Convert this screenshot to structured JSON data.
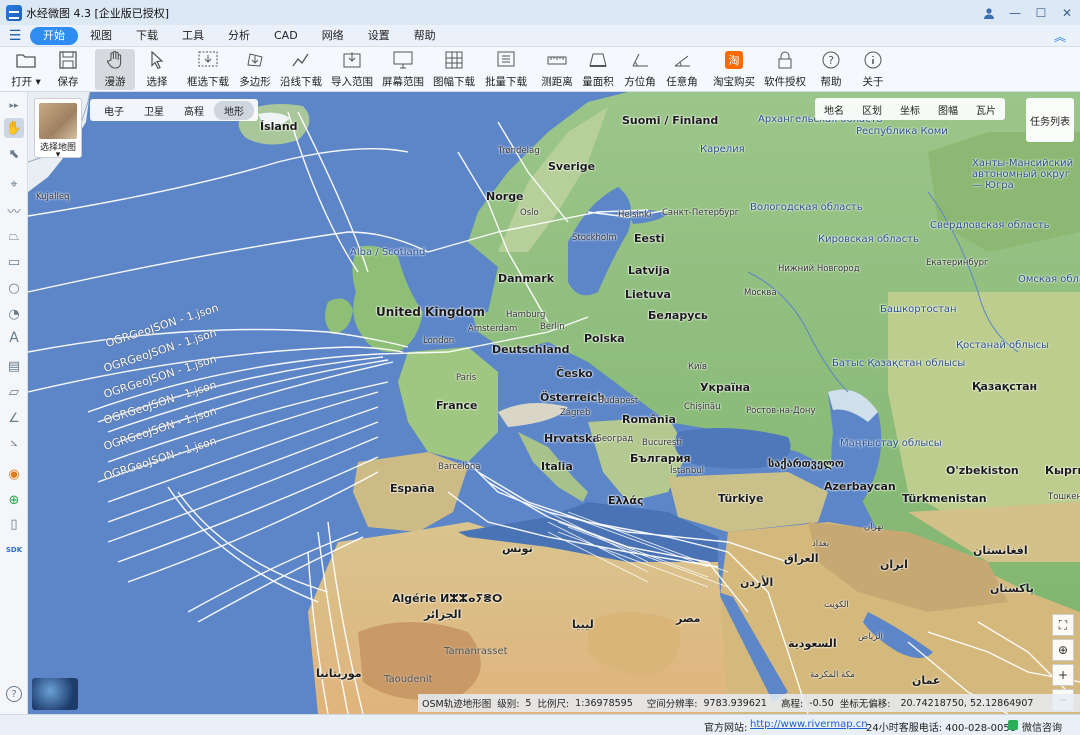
{
  "window": {
    "title": "水经微图 4.3 [企业版已授权]"
  },
  "menu": [
    "开始",
    "视图",
    "下载",
    "工具",
    "分析",
    "CAD",
    "网络",
    "设置",
    "帮助"
  ],
  "toolbar": {
    "open": "打开",
    "open_arrow": "▾",
    "save": "保存",
    "roam": "漫游",
    "select": "选择",
    "box_download": "框选下载",
    "polygon": "多边形",
    "line_download": "沿线下载",
    "import_range": "导入范围",
    "screen_range": "屏幕范围",
    "sheet_download": "图幅下载",
    "batch_download": "批量下载",
    "measure_distance": "测距离",
    "measure_area": "量面积",
    "bearing": "方位角",
    "any_angle": "任意角",
    "taobao": "淘宝购买",
    "license": "软件授权",
    "help": "帮助",
    "about": "关于",
    "taobao_glyph": "淘"
  },
  "map_picker": {
    "label": "选择地图",
    "arrow": "▾"
  },
  "map_types": [
    "电子",
    "卫星",
    "高程",
    "地形"
  ],
  "map_type_active": "地形",
  "right_tabs": [
    "地名",
    "区划",
    "坐标",
    "图幅",
    "瓦片"
  ],
  "task_list": "任务列表",
  "geojson_label": "OGRGeoJSON - 1.json",
  "labels": {
    "island": "Ísland",
    "suomi": "Suomi / Finland",
    "sverige": "Sverige",
    "norge": "Norge",
    "eesti": "Eesti",
    "latvija": "Latvija",
    "lietuva": "Lietuva",
    "danmark": "Danmark",
    "uk": "United Kingdom",
    "alba": "Alba / Scotland",
    "deutschland": "Deutschland",
    "polska": "Polska",
    "belarus": "Беларусь",
    "cesko": "Česko",
    "france": "France",
    "osterreich": "Österreich",
    "ukraina": "Україна",
    "romania": "România",
    "hrvatska": "Hrvatska",
    "italia": "Italia",
    "bulgaria": "България",
    "espana": "España",
    "ellas": "Ελλάς",
    "turkiye": "Türkiye",
    "georgia": "საქართველო",
    "azerbaycan": "Azerbaycan",
    "kazakhstan": "Қазақстан",
    "uzbekiston": "O'zbekiston",
    "turkmenistan": "Türkmenistan",
    "algerie": "Algérie ⵍⵣⵣⴰⵢⴻⵔ",
    "algeria_ar": "الجزائر",
    "tunis": "تونس",
    "libya": "ليبيا",
    "misr": "مصر",
    "iraq": "العراق",
    "iran": "ایران",
    "saudi": "السعودية",
    "afghanistan": "افغانستان",
    "pakistan": "پاکستان",
    "mauritania": "موريتانيا",
    "jordan": "الأردن",
    "oman": "عمان",
    "tamanrasset": "Tamanrasset",
    "taoudenit": "Taoudenit",
    "kyrgyz": "Кыргыз",
    "arkhangelsk": "Архангельская область",
    "komi": "Республика Коми",
    "karelia": "Карелия",
    "khanty": "Ханты-Мансийский автономный округ — Югра",
    "vologda": "Вологодская область",
    "kirov": "Кировская область",
    "sverdlovsk": "Свердловская область",
    "nizhny": "Нижний Новгород",
    "moskva": "Москва",
    "bashkort": "Башкортостан",
    "kostanay": "Қостанай облысы",
    "omsk": "Омская область",
    "batys": "Батыс Қазақстан облысы",
    "mangystau": "Маңғыстау облысы",
    "rostov": "Ростов-на-Дону",
    "oslo": "Oslo",
    "stockholm": "Stockholm",
    "helsinki": "Helsinki",
    "spb": "Санкт-Петербург",
    "london": "London",
    "paris": "Paris",
    "berlin": "Berlin",
    "hamburg": "Hamburg",
    "amsterdam": "Amsterdam",
    "kyiv": "Київ",
    "budapest": "Budapest",
    "chisinau": "Chişinău",
    "bucuresti": "București",
    "zagreb": "Zagreb",
    "beograd": "Београд",
    "barcelona": "Barcelona",
    "istanbul": "İstanbul",
    "tehran": "تهران",
    "baghdad": "بغداد",
    "kuwait": "الكويت",
    "riyadh": "الرياض",
    "makkah": "مكة المكرمة",
    "ekaterinburg": "Екатеринбург",
    "tashkent": "Тошкент",
    "trondelag": "Trøndelag",
    "kujalleq": "Kujalleq"
  },
  "status": {
    "layer": "OSM轨迹地形图",
    "level_label": "级别:",
    "level": "5",
    "scale_label": "比例尺:",
    "scale": "1:36978595",
    "resolution_label": "空间分辨率:",
    "resolution": "9783.939621",
    "elev_label": "高程:",
    "elev": "-0.50",
    "coord_label": "坐标无偏移:",
    "coord": "20.74218750, 52.12864907"
  },
  "bottom": {
    "site_label": "官方网站:",
    "site_url": "http://www.rivermap.cn",
    "phone": "24小时客服电话: 400-028-0050",
    "wechat": "微信咨询"
  },
  "colors": {
    "accent": "#2f8cf0",
    "sea": "#5d86c8",
    "route": "#ffffff"
  }
}
